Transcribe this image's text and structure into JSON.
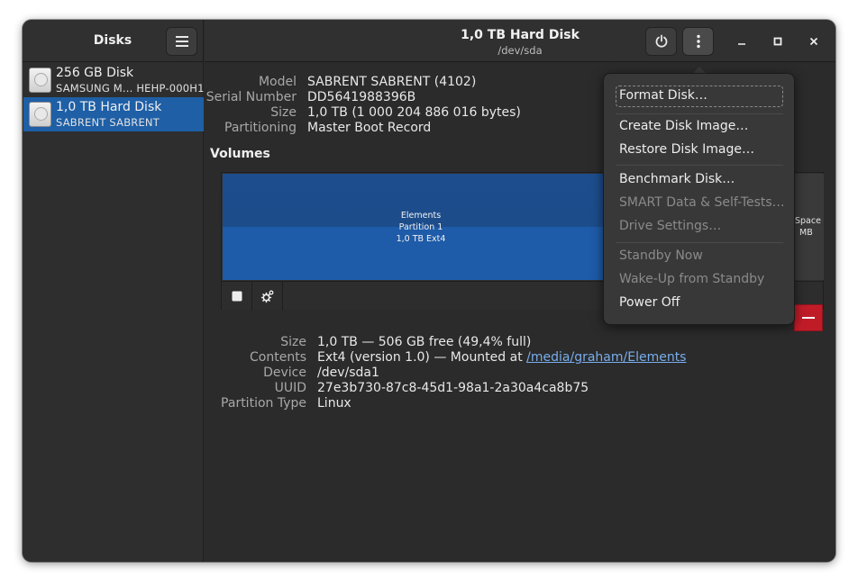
{
  "sidebar": {
    "title": "Disks",
    "items": [
      {
        "name": "256 GB Disk",
        "sub": "SAMSUNG M... HEHP-000H1",
        "selected": false
      },
      {
        "name": "1,0 TB Hard Disk",
        "sub": "SABRENT SABRENT",
        "selected": true
      }
    ]
  },
  "header": {
    "title": "1,0 TB Hard Disk",
    "subtitle": "/dev/sda"
  },
  "drive": {
    "model_label": "Model",
    "model": "SABRENT SABRENT (4102)",
    "serial_label": "Serial Number",
    "serial": "DD5641988396B",
    "size_label": "Size",
    "size": "1,0 TB (1 000 204 886 016 bytes)",
    "partitioning_label": "Partitioning",
    "partitioning": "Master Boot Record"
  },
  "volumes": {
    "title": "Volumes",
    "partition": {
      "line1": "Elements",
      "line2": "Partition 1",
      "line3": "1,0 TB Ext4"
    },
    "free": {
      "line1": "Space",
      "line2": "MB"
    }
  },
  "volume_details": {
    "size_label": "Size",
    "size": "1,0 TB — 506 GB free (49,4% full)",
    "contents_label": "Contents",
    "contents_prefix": "Ext4 (version 1.0) — Mounted at ",
    "contents_link": "/media/graham/Elements",
    "device_label": "Device",
    "device": "/dev/sda1",
    "uuid_label": "UUID",
    "uuid": "27e3b730-87c8-45d1-98a1-2a30a4ca8b75",
    "ptype_label": "Partition Type",
    "ptype": "Linux"
  },
  "menu": {
    "format": "Format Disk…",
    "create_image": "Create Disk Image…",
    "restore_image": "Restore Disk Image…",
    "benchmark": "Benchmark Disk…",
    "smart": "SMART Data & Self-Tests…",
    "settings": "Drive Settings…",
    "standby": "Standby Now",
    "wakeup": "Wake-Up from Standby",
    "poweroff": "Power Off"
  },
  "icons": {
    "power": "power-icon",
    "more": "vertical-dots-icon",
    "minimize": "minimize-icon",
    "maximize": "maximize-icon",
    "close": "close-icon",
    "stop": "stop-icon",
    "gears": "gears-icon",
    "minus": "minus-icon"
  },
  "colors": {
    "accent": "#1e5fa6",
    "partition": "#1e5ba8",
    "danger": "#c01c28",
    "link": "#78aeed"
  }
}
